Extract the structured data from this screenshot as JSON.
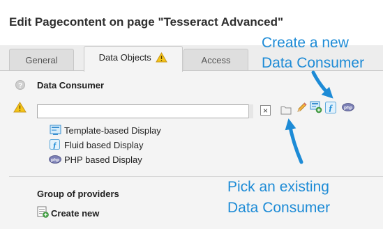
{
  "page_title": "Edit Pagecontent on page \"Tesseract Advanced\"",
  "tabs": [
    {
      "label": "General"
    },
    {
      "label": "Data Objects"
    },
    {
      "label": "Access"
    }
  ],
  "data_consumer": {
    "heading": "Data Consumer",
    "field_value": "",
    "clear_label": "×",
    "options": [
      {
        "label": "Template-based Display",
        "icon": "template-display-icon"
      },
      {
        "label": "Fluid based Display",
        "icon": "fluid-icon"
      },
      {
        "label": "PHP based Display",
        "icon": "php-icon"
      }
    ]
  },
  "providers": {
    "heading": "Group of providers",
    "create_label": "Create new"
  },
  "annotations": {
    "create_line1": "Create a new",
    "create_line2": "Data Consumer",
    "pick_line1": "Pick an existing",
    "pick_line2": "Data Consumer"
  },
  "colors": {
    "annotation": "#1d8bd6",
    "warning": "#f5c518",
    "panel": "#f4f4f4"
  }
}
